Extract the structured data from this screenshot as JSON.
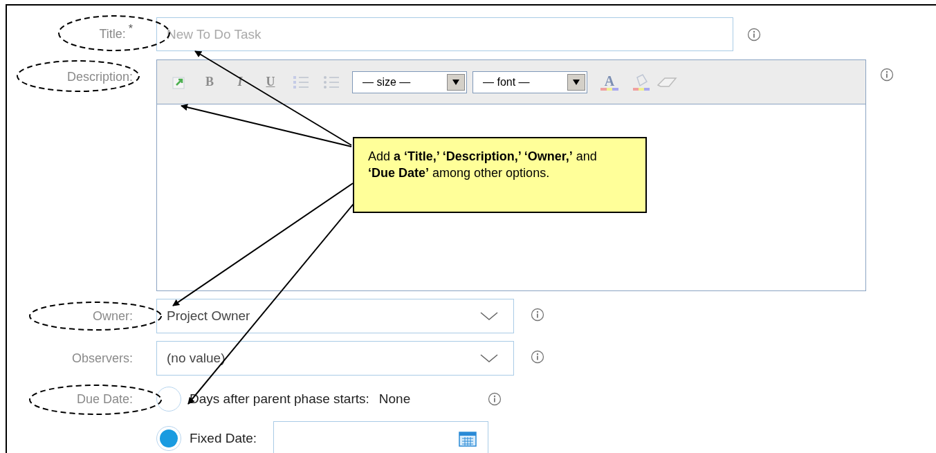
{
  "title_field": {
    "label": "Title:",
    "required_mark": "*",
    "placeholder": "New To Do Task"
  },
  "description": {
    "label": "Description:",
    "toolbar": [
      {
        "kind": "image"
      },
      {
        "kind": "bold",
        "label": "B"
      },
      {
        "kind": "italic",
        "label": "I"
      },
      {
        "kind": "underline",
        "label": "U"
      },
      {
        "kind": "ordered-list"
      },
      {
        "kind": "bullet-list"
      },
      {
        "kind": "select",
        "value": "— size —"
      },
      {
        "kind": "select",
        "value": "— font —"
      },
      {
        "kind": "font-color",
        "label": "A"
      },
      {
        "kind": "fill-color"
      },
      {
        "kind": "eraser"
      }
    ]
  },
  "owner": {
    "label": "Owner:",
    "value": "Project Owner"
  },
  "observers": {
    "label": "Observers:",
    "value": "(no value)"
  },
  "due_date": {
    "label": "Due Date:",
    "options": [
      {
        "kind": "days",
        "label": "Days after parent phase starts:",
        "value": "None",
        "selected": false
      },
      {
        "kind": "fixed",
        "label": "Fixed Date:",
        "selected": true
      }
    ]
  },
  "callout": {
    "text": "Add **a ‘Title,’ ‘Description,’ ‘Owner,’** and **‘Due Date’** among other options."
  }
}
